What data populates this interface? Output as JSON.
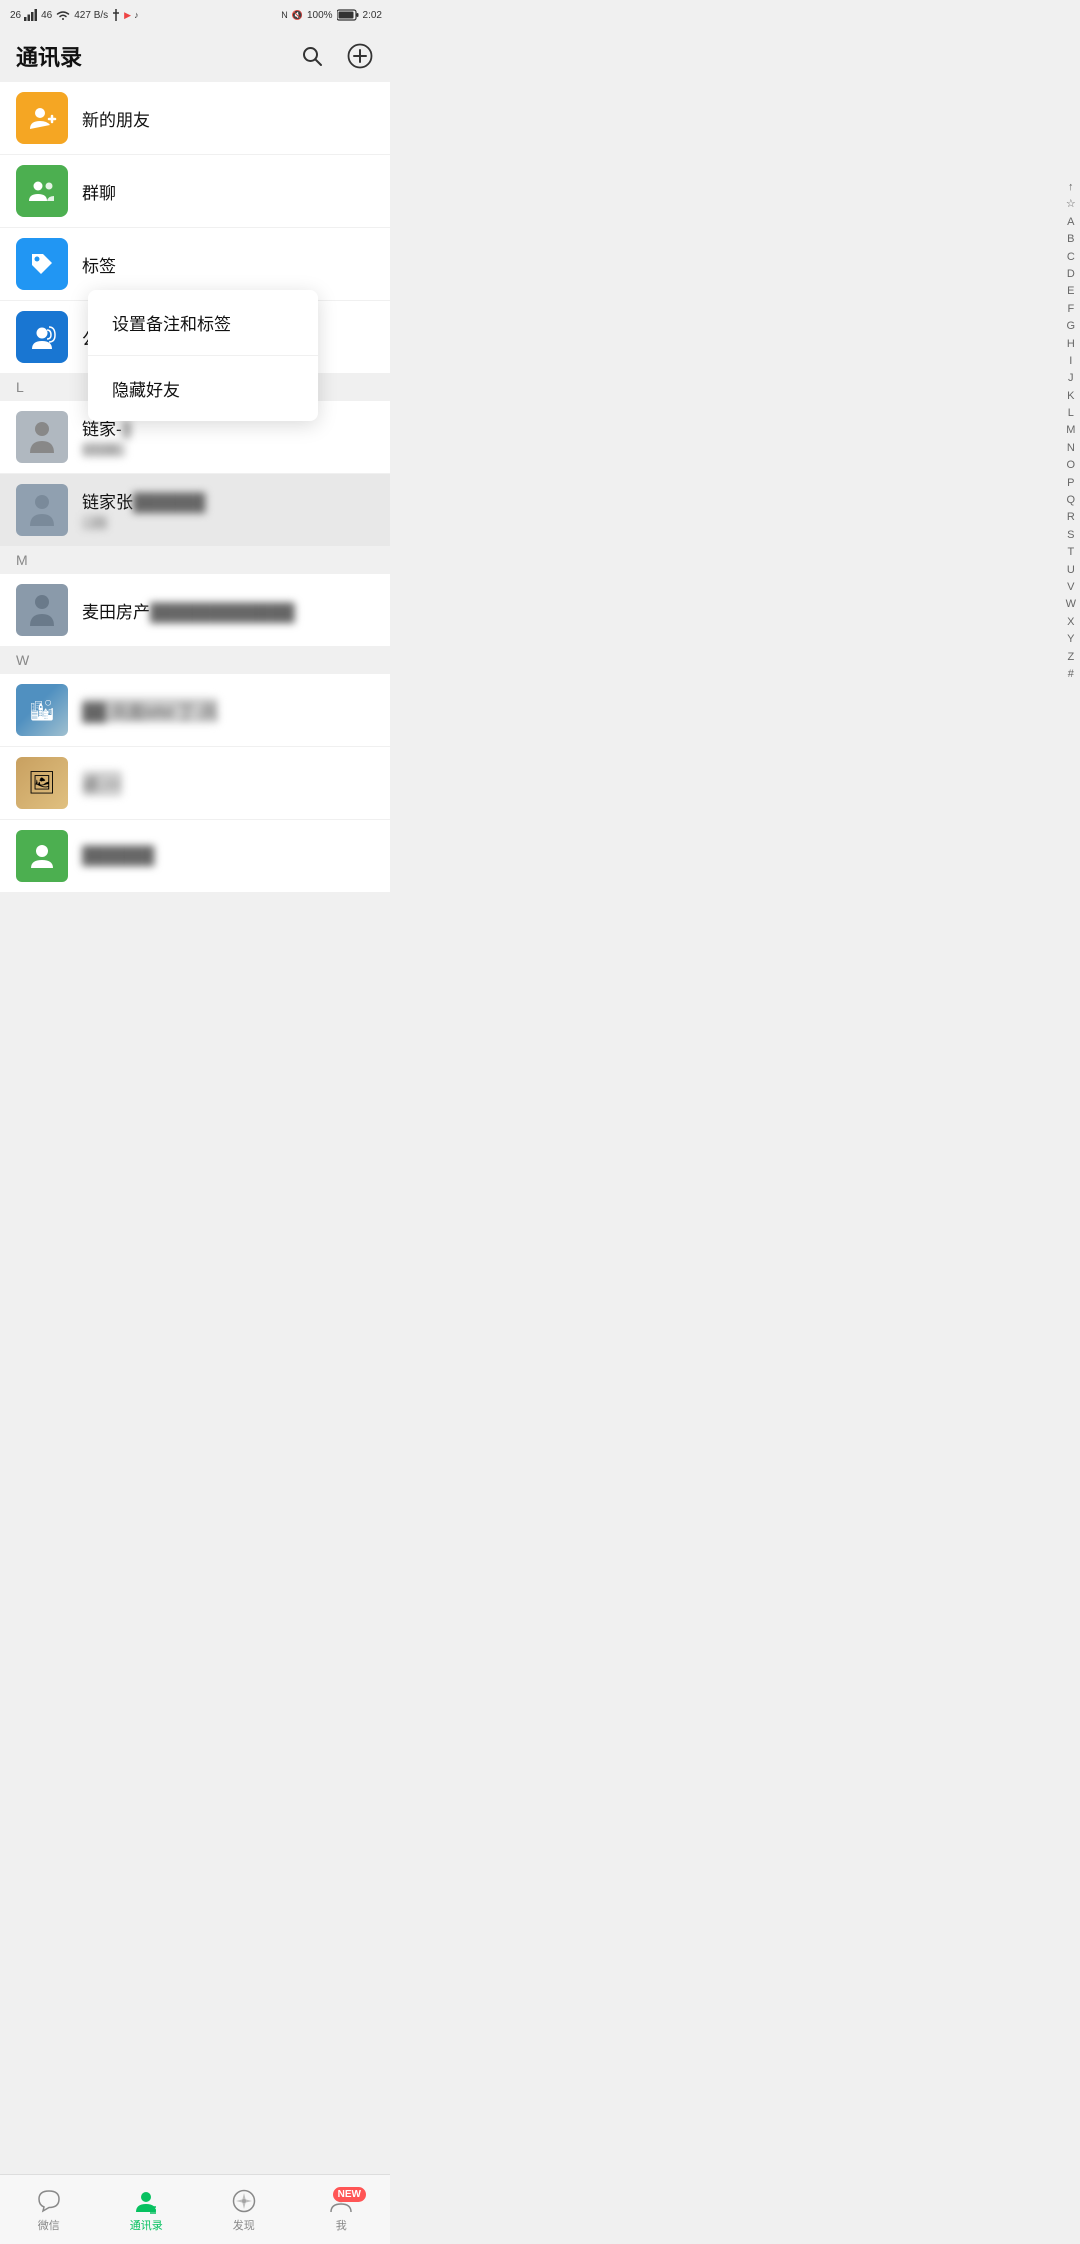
{
  "statusBar": {
    "carrier": "26",
    "signal": "46",
    "wifi": "wifi",
    "speed": "427 B/s",
    "battery": "100%",
    "time": "2:02"
  },
  "header": {
    "title": "通讯录",
    "searchLabel": "search",
    "addLabel": "add"
  },
  "quickItems": [
    {
      "id": "new-friends",
      "label": "新的朋友",
      "iconType": "orange",
      "icon": "person-add"
    },
    {
      "id": "group-chat",
      "label": "群聊",
      "iconType": "green",
      "icon": "group"
    },
    {
      "id": "tags",
      "label": "标签",
      "iconType": "blue-tag",
      "icon": "tag"
    },
    {
      "id": "public-account",
      "label": "公众号",
      "iconType": "blue-person",
      "icon": "public"
    }
  ],
  "sections": [
    {
      "letter": "L",
      "contacts": [
        {
          "id": "lianjia1",
          "name": "链家-3",
          "subtext": "10166...",
          "avatarColor": "#b0b8c0"
        },
        {
          "id": "lianjia2",
          "name": "链家张",
          "subtext": "...21",
          "avatarColor": "#90a0b0",
          "highlighted": true
        }
      ]
    },
    {
      "letter": "M",
      "contacts": [
        {
          "id": "maitian",
          "name": "麦田房产",
          "subtext": "",
          "avatarColor": "#8a9aaa"
        }
      ]
    },
    {
      "letter": "W",
      "contacts": [
        {
          "id": "w1",
          "name": "██ 凤凰MM 丁·凤",
          "subtext": "",
          "avatarColor": "#a0c0d0"
        },
        {
          "id": "w2",
          "name": "卓·一",
          "subtext": "",
          "avatarColor": "#b0a080"
        },
        {
          "id": "w3",
          "name": "",
          "subtext": "",
          "avatarColor": "#4caf50"
        }
      ]
    }
  ],
  "contextMenu": {
    "visible": true,
    "items": [
      {
        "id": "set-remark",
        "label": "设置备注和标签"
      },
      {
        "id": "hide-friend",
        "label": "隐藏好友"
      }
    ]
  },
  "alphaIndex": [
    "↑",
    "☆",
    "A",
    "B",
    "C",
    "D",
    "E",
    "F",
    "G",
    "H",
    "I",
    "J",
    "K",
    "L",
    "M",
    "N",
    "O",
    "P",
    "Q",
    "R",
    "S",
    "T",
    "U",
    "V",
    "W",
    "X",
    "Y",
    "Z",
    "#"
  ],
  "bottomNav": [
    {
      "id": "weixin",
      "label": "微信",
      "active": false,
      "icon": "chat",
      "badge": null
    },
    {
      "id": "contacts",
      "label": "通讯录",
      "active": true,
      "icon": "contacts",
      "badge": null
    },
    {
      "id": "discover",
      "label": "发现",
      "active": false,
      "icon": "compass",
      "badge": null
    },
    {
      "id": "me",
      "label": "我",
      "active": false,
      "icon": "person",
      "badge": "NEW"
    }
  ]
}
